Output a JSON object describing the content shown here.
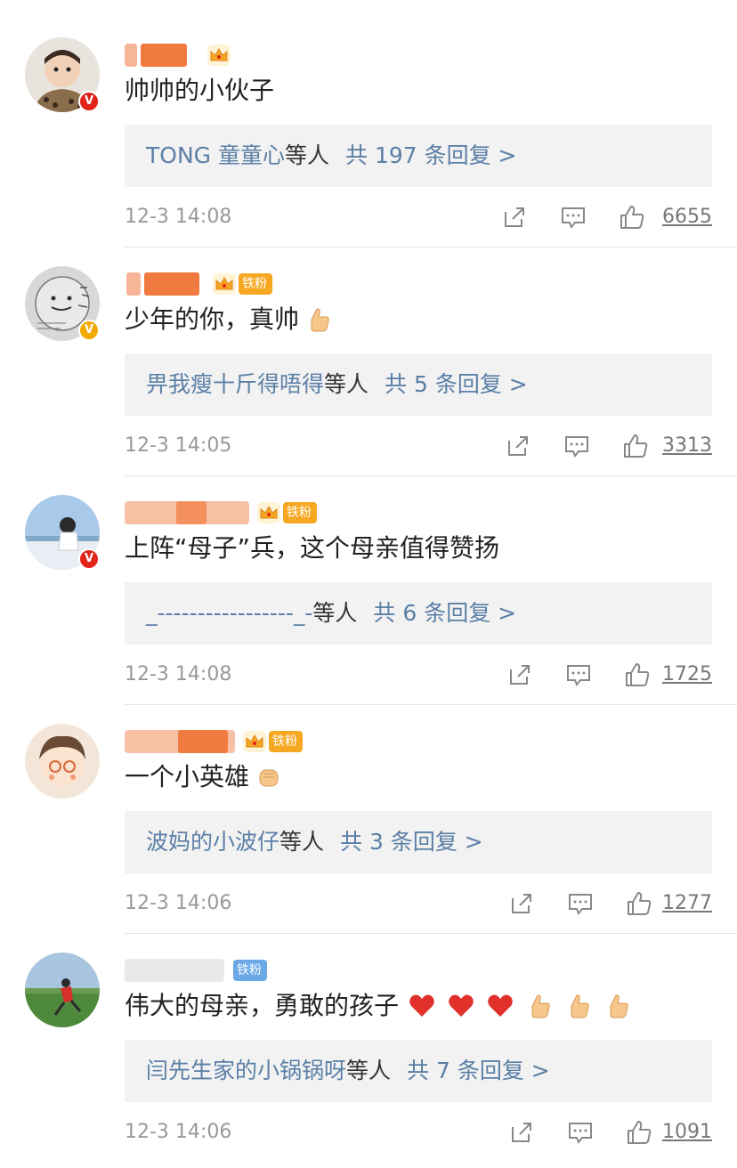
{
  "comments": [
    {
      "username": "",
      "text": "帅帅的小伙子",
      "fan_badge": "",
      "reply_users": "TONG 童童心",
      "reply_suffix": "等人",
      "reply_count": "共 197 条回复 >",
      "time": "12-3 14:08",
      "likes": "6655"
    },
    {
      "username": "",
      "text": "少年的你，真帅",
      "fan_badge": "铁粉",
      "reply_users": "畀我瘦十斤得唔得",
      "reply_suffix": "等人",
      "reply_count": "共 5 条回复 >",
      "time": "12-3 14:05",
      "likes": "3313"
    },
    {
      "username": "",
      "text": "上阵“母子”兵，这个母亲值得赞扬",
      "fan_badge": "铁粉",
      "reply_users": "_-----------------_-",
      "reply_suffix": "等人",
      "reply_count": "共 6 条回复 >",
      "time": "12-3 14:08",
      "likes": "1725"
    },
    {
      "username": "",
      "text": "一个小英雄",
      "fan_badge": "铁粉",
      "reply_users": "波妈的小波仔",
      "reply_suffix": "等人",
      "reply_count": "共 3 条回复 >",
      "time": "12-3 14:06",
      "likes": "1277"
    },
    {
      "username": "",
      "text": "伟大的母亲，勇敢的孩子",
      "fan_badge": "铁粉",
      "reply_users": "闫先生家的小锅锅呀",
      "reply_suffix": "等人",
      "reply_count": "共 7 条回复 >",
      "time": "12-3 14:06",
      "likes": "1091"
    }
  ],
  "icons": {
    "share": "share-icon",
    "comment": "comment-icon",
    "like": "thumbs-up-icon",
    "verified": "verified-v-badge-icon",
    "crown": "crown-icon",
    "heart": "red-heart-emoji",
    "thumb": "thumbs-up-emoji",
    "fist": "fist-emoji"
  },
  "colors": {
    "link": "#5b7fa6",
    "reply_bg": "#f2f2f2",
    "fan_badge": "#f7a823",
    "fan_badge_blue": "#6aa8e6",
    "verified_red": "#e2231a",
    "verified_gold": "#f2a900",
    "meta": "#999999"
  }
}
